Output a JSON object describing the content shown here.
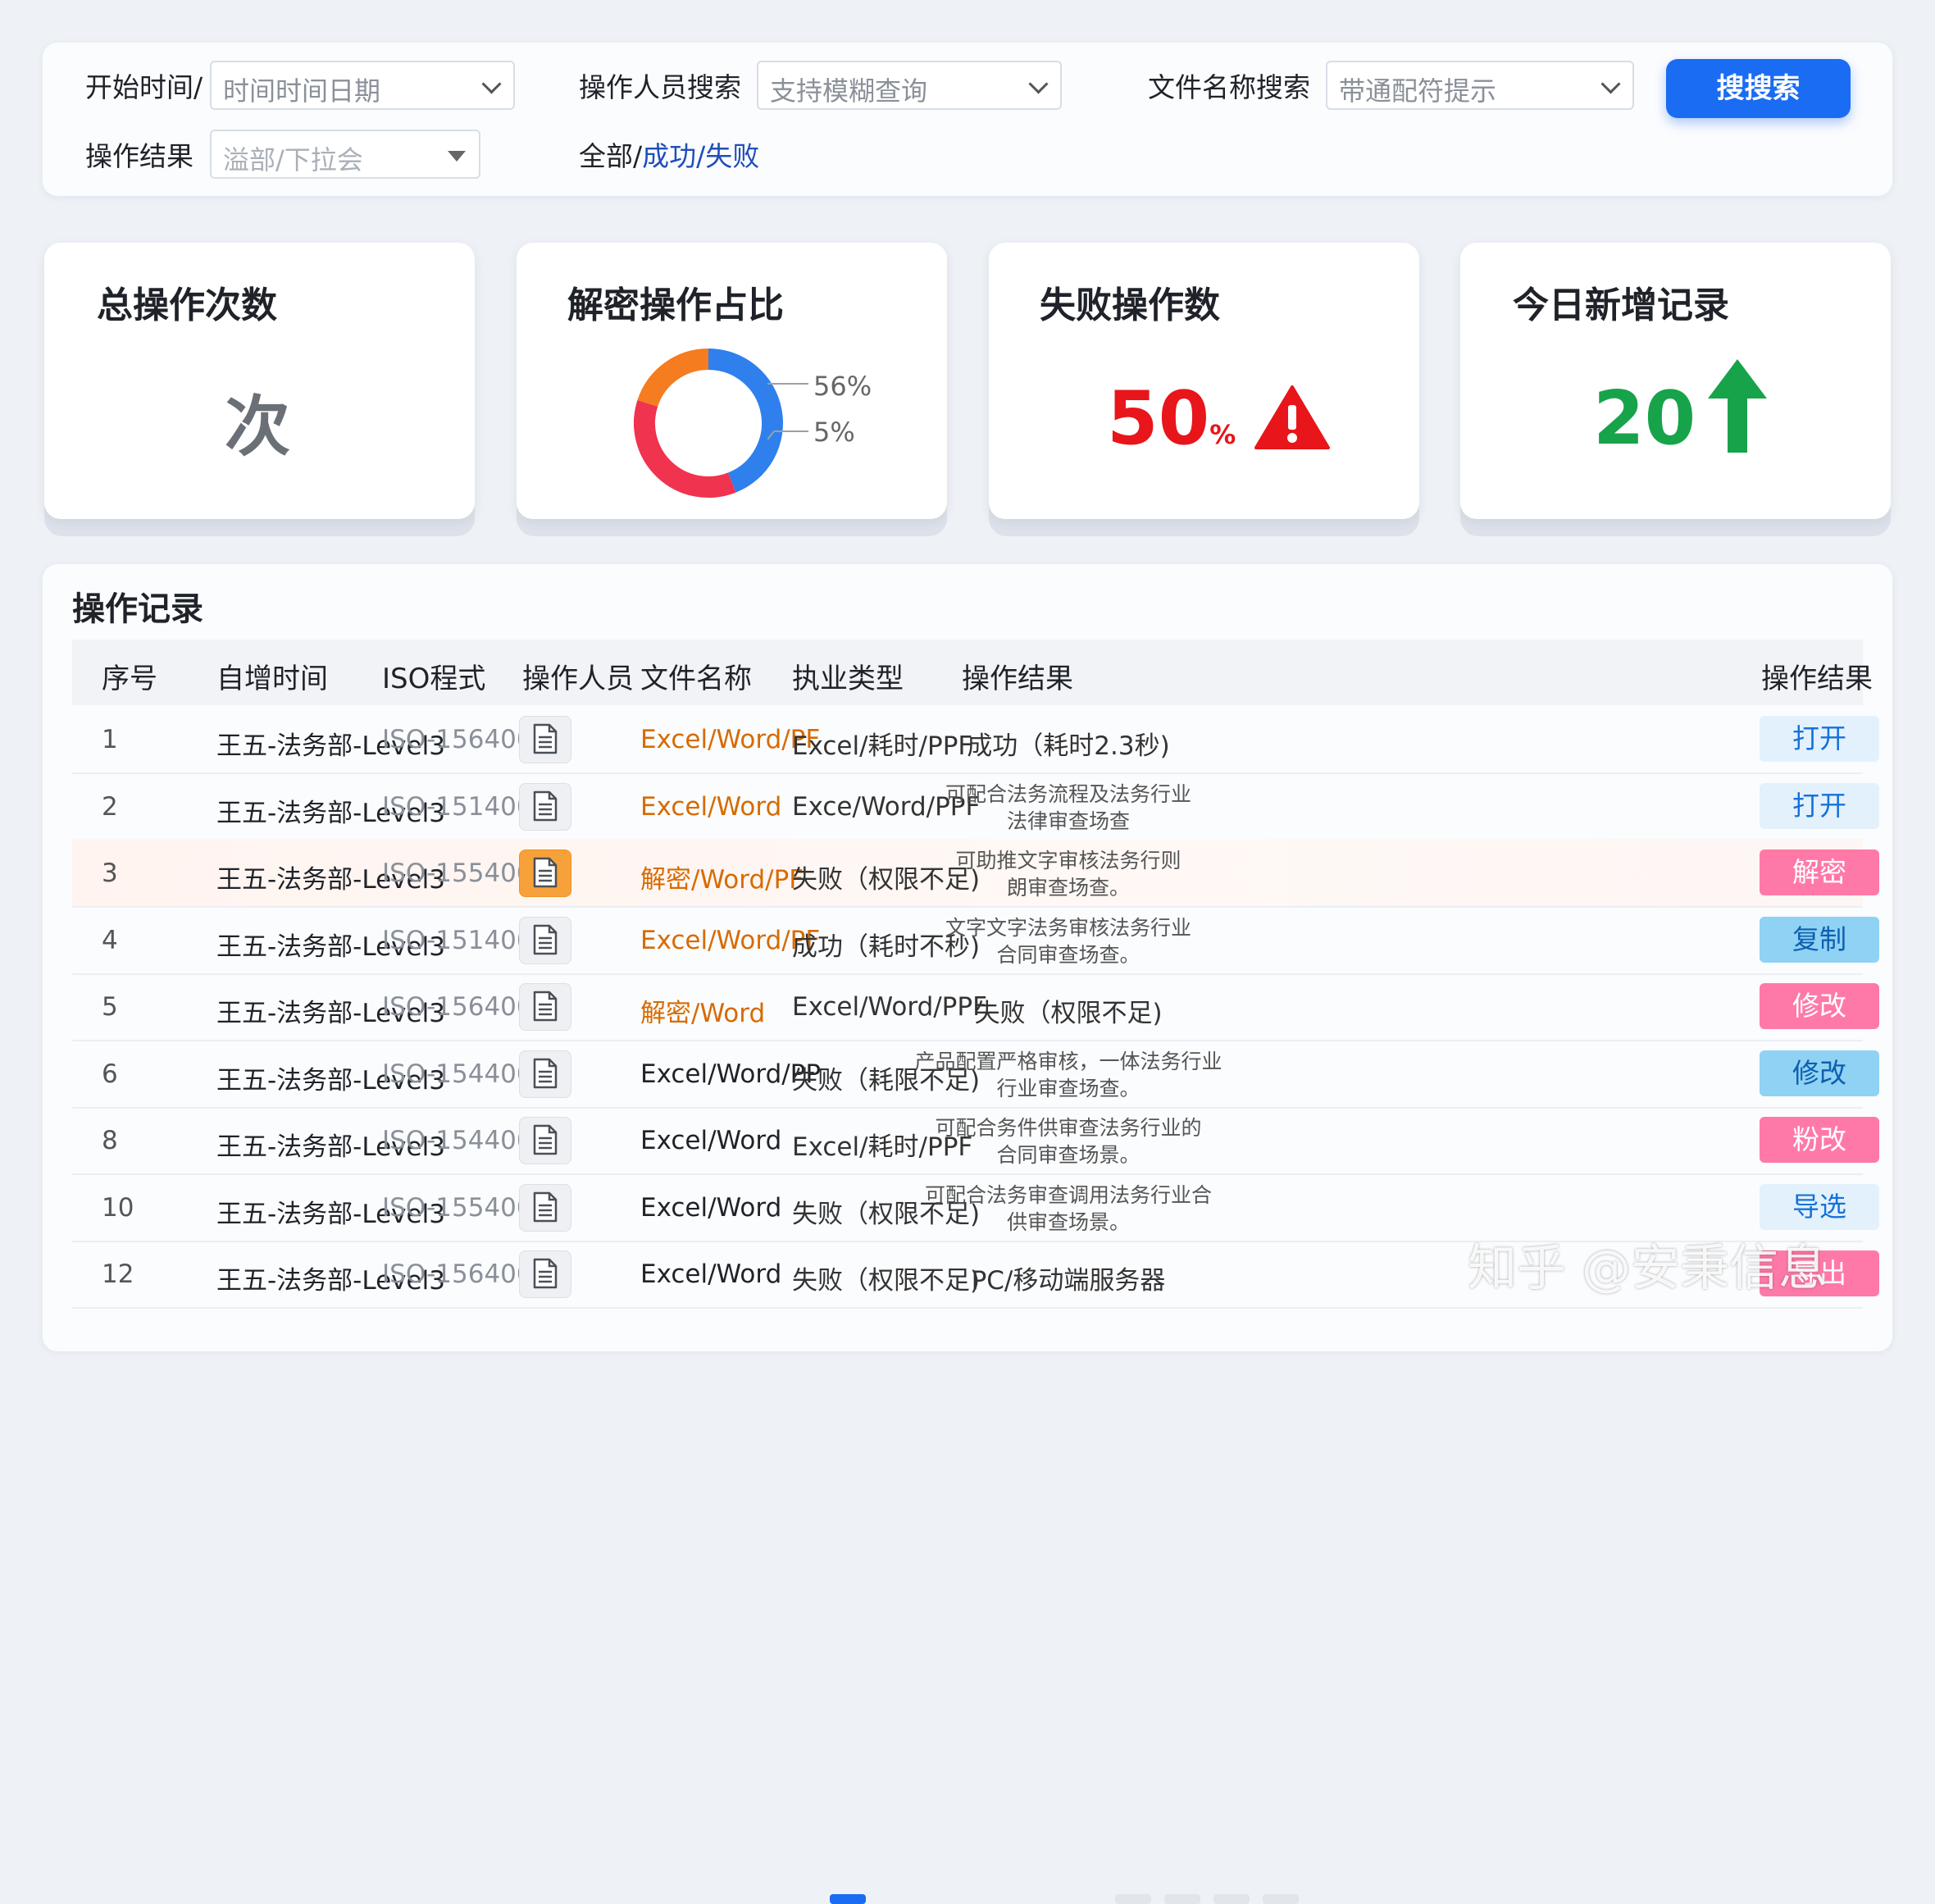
{
  "filters": {
    "start_time_label": "开始时间/",
    "start_time_placeholder": "时间时间日期",
    "operator_label": "操作人员搜索",
    "operator_placeholder": "支持模糊查询",
    "filename_label": "文件名称搜索",
    "filename_placeholder": "带通配符提示",
    "search_button": "搜搜索",
    "result_label": "操作结果",
    "result_placeholder": "溢部/下拉会",
    "result_all": "全部/",
    "result_success": "成功/",
    "result_fail": "失败"
  },
  "cards": {
    "total": {
      "title": "总操作次数",
      "value": "次"
    },
    "decrypt": {
      "title": "解密操作占比",
      "labels": [
        "56%",
        "5%"
      ],
      "chart_data": {
        "type": "pie",
        "segments": [
          {
            "value": 44,
            "color": "#2f80ed"
          },
          {
            "value": 36,
            "color": "#f0334e"
          },
          {
            "value": 20,
            "color": "#f57c1f"
          }
        ]
      }
    },
    "failed": {
      "title": "失败操作数",
      "value": "50",
      "unit": "%",
      "color": "#e8151b"
    },
    "today": {
      "title": "今日新增记录",
      "value": "20",
      "color": "#17a34a"
    }
  },
  "records": {
    "title": "操作记录",
    "headers": [
      "序号",
      "自增时间",
      "ISO程式",
      "操作人员",
      "文件名称",
      "执业类型",
      "操作结果",
      "操作结果"
    ],
    "rows": [
      {
        "idx": "1",
        "user": "王五-法务部-Level3",
        "iso": "ISO-15640022",
        "file": "Excel/Word/PF",
        "type": "Excel/耗时/PPF",
        "result": "成功（耗时2.3秒)",
        "result_lines": [
          "成功（耗时2.3秒)"
        ],
        "action": "打开",
        "action_style": "blue",
        "file_orange": true,
        "highlight": false,
        "doc_orange": false
      },
      {
        "idx": "2",
        "user": "王五-法务部-Level3",
        "iso": "ISO-15140023",
        "file": "Excel/Word",
        "type": "Exce/Word/PPF",
        "result": "可配合法务流程及法务行业",
        "result2": "法律审查场查",
        "action": "打开",
        "action_style": "blue",
        "file_orange": true,
        "highlight": false,
        "doc_orange": false
      },
      {
        "idx": "3",
        "user": "王五-法务部-Level3",
        "iso": "ISO-15540027",
        "file": "解密/Word/PF",
        "type": "失败（权限不足)",
        "result": "可助推文字审核法务行则",
        "result2": "朗审查场查。",
        "action": "解密",
        "action_style": "pink",
        "file_orange": true,
        "highlight": true,
        "doc_orange": true
      },
      {
        "idx": "4",
        "user": "王五-法务部-Level3",
        "iso": "ISO-15140026",
        "file": "Excel/Word/PF",
        "type": "成功（耗时不秒)",
        "result": "文字文字法务审核法务行业",
        "result2": "合同审查场查。",
        "action": "复制",
        "action_style": "cyan",
        "file_orange": true,
        "highlight": false,
        "doc_orange": false
      },
      {
        "idx": "5",
        "user": "王五-法务部-Level3",
        "iso": "ISO-15640024",
        "file": "解密/Word",
        "type": "Excel/Word/PPF",
        "result": "失败（权限不足)",
        "action": "修改",
        "action_style": "pink",
        "file_orange": true,
        "highlight": false,
        "doc_orange": false
      },
      {
        "idx": "6",
        "user": "王五-法务部-Level3",
        "iso": "ISO-15440027",
        "file": "Excel/Word/PP",
        "type": "失败（耗限不足)",
        "result": "产品配置严格审核，一体法务行业",
        "result2": "行业审查场查。",
        "action": "修改",
        "action_style": "cyan",
        "file_orange": false,
        "highlight": false,
        "doc_orange": false
      },
      {
        "idx": "8",
        "user": "王五-法务部-Level3",
        "iso": "ISO-15440024",
        "file": "Excel/Word",
        "type": "Excel/耗时/PPF",
        "result": "可配合务件供审查法务行业的",
        "result2": "合同审查场景。",
        "action": "粉改",
        "action_style": "pink",
        "file_orange": false,
        "highlight": false,
        "doc_orange": false
      },
      {
        "idx": "10",
        "user": "王五-法务部-Level3",
        "iso": "ISO-15540024",
        "file": "Excel/Word",
        "type": "失败（权限不足)",
        "result": "可配合法务审查调用法务行业合",
        "result2": "供审查场景。",
        "action": "导选",
        "action_style": "blue",
        "file_orange": false,
        "highlight": false,
        "doc_orange": false
      },
      {
        "idx": "12",
        "user": "王五-法务部-Level3",
        "iso": "ISO-15640024",
        "file": "Excel/Word",
        "type": "失败（权限不足)",
        "result": "PC/移动端服务器",
        "action": "导出",
        "action_style": "pink",
        "file_orange": false,
        "highlight": false,
        "doc_orange": false
      }
    ]
  },
  "watermark": "知乎 @安秉信息"
}
